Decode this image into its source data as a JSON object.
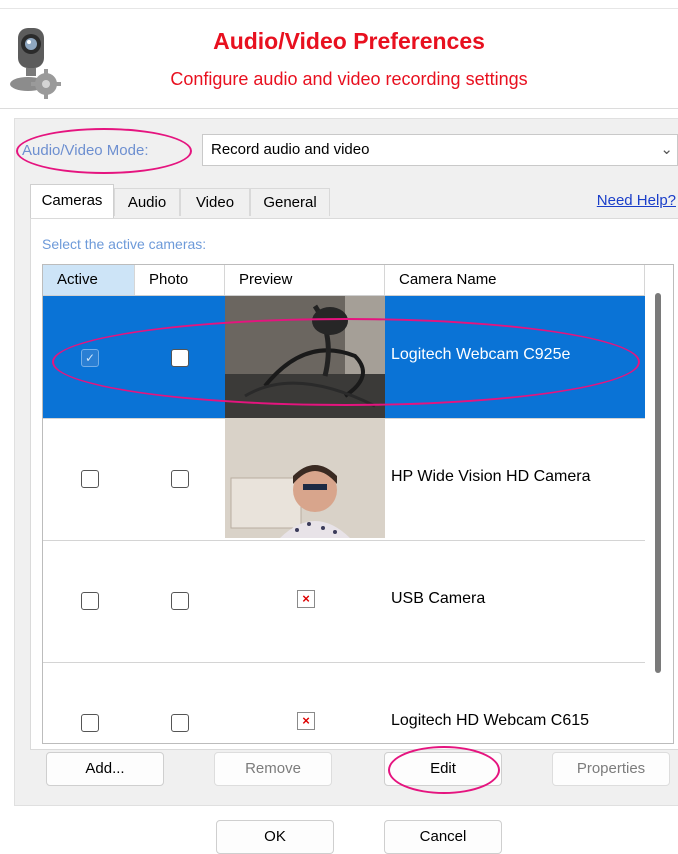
{
  "header": {
    "title": "Audio/Video Preferences",
    "subtitle": "Configure audio and video recording settings",
    "logo_icon": "webcam-gear-icon"
  },
  "mode": {
    "label": "Audio/Video Mode:",
    "value": "Record audio and video"
  },
  "tabs": [
    {
      "label": "Cameras",
      "active": true
    },
    {
      "label": "Audio",
      "active": false
    },
    {
      "label": "Video",
      "active": false
    },
    {
      "label": "General",
      "active": false
    }
  ],
  "help_link": "Need Help?",
  "cameras_instruction": "Select the active cameras:",
  "columns": [
    "Active",
    "Photo",
    "Preview",
    "Camera Name"
  ],
  "rows": [
    {
      "name": "Logitech Webcam C925e",
      "active": true,
      "photo": false,
      "preview": "webcam-image",
      "selected": true
    },
    {
      "name": "HP Wide Vision HD Camera",
      "active": false,
      "photo": false,
      "preview": "person-image",
      "selected": false
    },
    {
      "name": "USB Camera",
      "active": false,
      "photo": false,
      "preview": "broken-image-icon",
      "selected": false
    },
    {
      "name": "Logitech HD Webcam C615",
      "active": false,
      "photo": false,
      "preview": "broken-image-icon",
      "selected": false
    }
  ],
  "buttons": {
    "add": "Add...",
    "remove": "Remove",
    "edit": "Edit",
    "properties": "Properties",
    "ok": "OK",
    "cancel": "Cancel"
  },
  "colors": {
    "title_red": "#e8101f",
    "selection_blue": "#0a73d6",
    "annotation_pink": "#e5147f",
    "link_blue": "#1a3ec9"
  }
}
